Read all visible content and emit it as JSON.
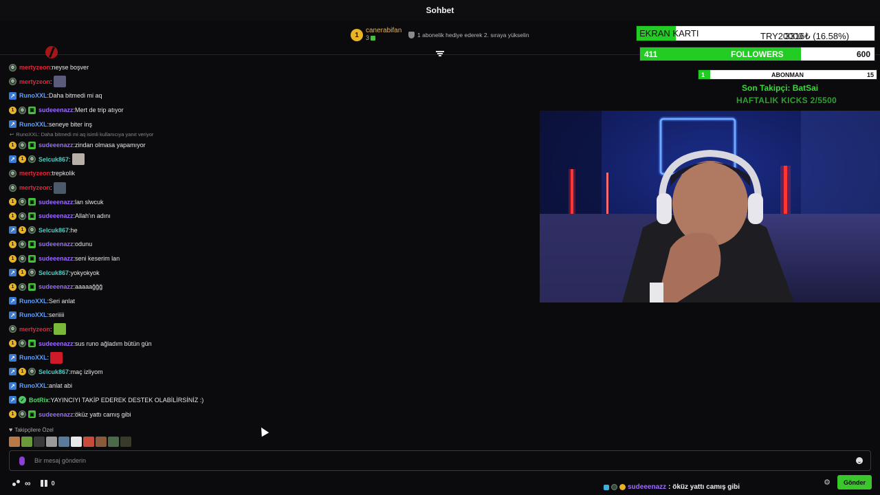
{
  "header": {
    "title": "Sohbet"
  },
  "pinned": {
    "gift_badge": "1",
    "user": "canerabifan",
    "count": "3",
    "message": "1 abonelik hediye ederek 2. sıraya yükselin"
  },
  "colors": {
    "accent_green": "#3ac72b",
    "user_red": "#e0283c",
    "user_purple": "#9b6bff",
    "user_blue": "#5aa0ff",
    "user_teal": "#4ecdc4",
    "user_lime": "#52d66a"
  },
  "chat": {
    "messages": [
      {
        "badges": [
          "lvl"
        ],
        "user": "mertyzeon",
        "color": "#e0283c",
        "text": "neyse boşver"
      },
      {
        "badges": [
          "lvl"
        ],
        "user": "mertyzeon",
        "color": "#e0283c",
        "text": "",
        "emote": "#5a5a7a"
      },
      {
        "badges": [
          "blue"
        ],
        "user": "RunoXXL",
        "color": "#5aa0ff",
        "text": "Daha bitmedi mi aq"
      },
      {
        "badges": [
          "coin",
          "lvl",
          "gift"
        ],
        "user": "sudeeenazz",
        "color": "#9b6bff",
        "text": "Mert de trip atıyor"
      },
      {
        "badges": [
          "blue"
        ],
        "user": "RunoXXL",
        "color": "#5aa0ff",
        "text": "seneye biter inş"
      },
      {
        "reply": "RunoXXL: Daha bitmedi mi aq isimli kullanıcıya yanıt veriyor"
      },
      {
        "badges": [
          "coin",
          "lvl",
          "gift"
        ],
        "user": "sudeeenazz",
        "color": "#9b6bff",
        "text": "zindan olmasa yapamıyor"
      },
      {
        "badges": [
          "blue",
          "coin",
          "lvl"
        ],
        "user": "Selcuk867",
        "color": "#4ecdc4",
        "text": "",
        "emote": "#b8b0a8"
      },
      {
        "badges": [
          "lvl"
        ],
        "user": "mertyzeon",
        "color": "#e0283c",
        "text": "trepkolik"
      },
      {
        "badges": [
          "lvl"
        ],
        "user": "mertyzeon",
        "color": "#e0283c",
        "text": "",
        "emote": "#4a5a6a"
      },
      {
        "badges": [
          "coin",
          "lvl",
          "gift"
        ],
        "user": "sudeeenazz",
        "color": "#9b6bff",
        "text": "lan slwcuk"
      },
      {
        "badges": [
          "coin",
          "lvl",
          "gift"
        ],
        "user": "sudeeenazz",
        "color": "#9b6bff",
        "text": "Allah'ın adını"
      },
      {
        "badges": [
          "blue",
          "coin",
          "lvl"
        ],
        "user": "Selcuk867",
        "color": "#4ecdc4",
        "text": "he"
      },
      {
        "badges": [
          "coin",
          "lvl",
          "gift"
        ],
        "user": "sudeeenazz",
        "color": "#9b6bff",
        "text": "odunu"
      },
      {
        "badges": [
          "coin",
          "lvl",
          "gift"
        ],
        "user": "sudeeenazz",
        "color": "#9b6bff",
        "text": "seni keserim lan"
      },
      {
        "badges": [
          "blue",
          "coin",
          "lvl"
        ],
        "user": "Selcuk867",
        "color": "#4ecdc4",
        "text": "yokyokyok"
      },
      {
        "badges": [
          "coin",
          "lvl",
          "gift"
        ],
        "user": "sudeeenazz",
        "color": "#9b6bff",
        "text": "aaaaağğğ"
      },
      {
        "badges": [
          "blue"
        ],
        "user": "RunoXXL",
        "color": "#5aa0ff",
        "text": "Seri anlat"
      },
      {
        "badges": [
          "blue"
        ],
        "user": "RunoXXL",
        "color": "#5aa0ff",
        "text": "seriiiii"
      },
      {
        "badges": [
          "lvl"
        ],
        "user": "mertyzeon",
        "color": "#e0283c",
        "text": "",
        "emote": "#7ab83a"
      },
      {
        "badges": [
          "coin",
          "lvl",
          "gift"
        ],
        "user": "sudeeenazz",
        "color": "#9b6bff",
        "text": "sus runo ağladım bütün gün"
      },
      {
        "badges": [
          "blue"
        ],
        "user": "RunoXXL",
        "color": "#5aa0ff",
        "text": "",
        "emote": "#d01a2a"
      },
      {
        "badges": [
          "blue",
          "coin",
          "lvl"
        ],
        "user": "Selcuk867",
        "color": "#4ecdc4",
        "text": "maç izliyom"
      },
      {
        "badges": [
          "blue"
        ],
        "user": "RunoXXL",
        "color": "#5aa0ff",
        "text": "anlat abi"
      },
      {
        "badges": [
          "blue",
          "bot"
        ],
        "user": "BotRix",
        "color": "#52d66a",
        "text": "YAYINCIYI TAKİP EDEREK DESTEK OLABİLİRSİNİZ :)"
      },
      {
        "badges": [
          "coin",
          "lvl",
          "gift"
        ],
        "user": "sudeeenazz",
        "color": "#9b6bff",
        "text": "öküz yattı camış gibi"
      }
    ]
  },
  "emote_panel": {
    "label": "Takipçilere Özel",
    "emote_colors": [
      "#b87848",
      "#6a9a3a",
      "#3a3a3a",
      "#9a9a9a",
      "#5a7a9a",
      "#e8e8e8",
      "#c84a3a",
      "#8a5a3a",
      "#4a6a4a",
      "#3a3a2a"
    ]
  },
  "input": {
    "placeholder": "Bir mesaj gönderin"
  },
  "bottom": {
    "infinity": "∞",
    "box_count": "0",
    "send_label": "Gönder"
  },
  "ticker": {
    "user": "sudeeenazz",
    "text": ": öküz yattı camış gibi"
  },
  "overlay": {
    "goal_label_bold": "EKRAN",
    "goal_label_rest": " KARTI",
    "goal_value": "3316₺ (16.58%)",
    "goal_target": "TRY20000",
    "goal_progress": 0.1658,
    "followers_current": "411",
    "followers_label": "FOLLOWERS",
    "followers_target": "600",
    "followers_progress": 0.685,
    "sub_current": "1",
    "sub_label": "ABONMAN",
    "sub_target": "15",
    "sub_progress": 0.0667,
    "last_follower": "Son Takipçi: BatSai",
    "weekly_kicks": "HAFTALIK KICKS 2/5500"
  }
}
